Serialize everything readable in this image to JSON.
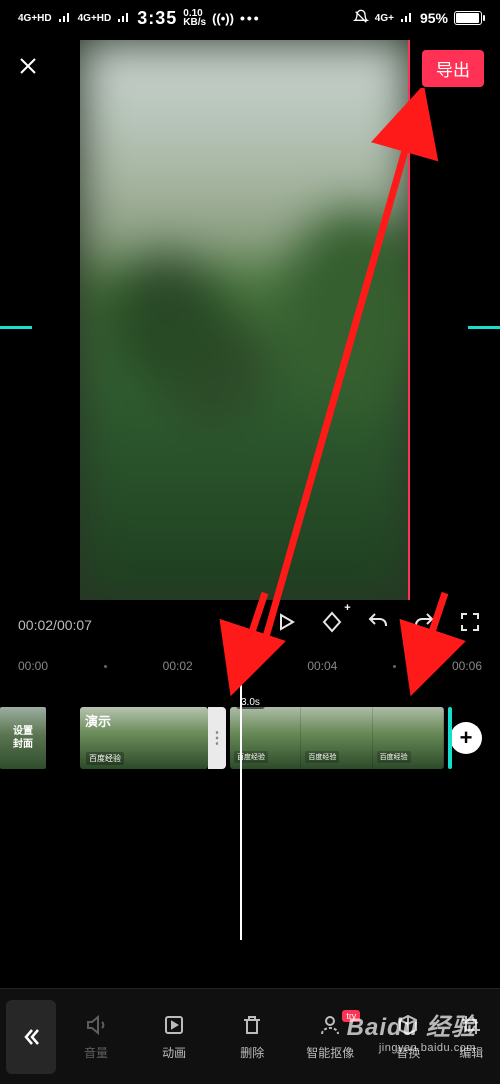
{
  "status": {
    "net_left": "4G+HD",
    "net_left2": "4G+HD",
    "time": "3:35",
    "speed_top": "0.10",
    "speed_bot": "KB/s",
    "net_right": "4G+",
    "battery": "95%"
  },
  "topbar": {
    "export_label": "导出"
  },
  "player": {
    "time_elapsed": "00:02",
    "time_total": "00:07"
  },
  "ruler": {
    "t0": "00:00",
    "t1": "00:02",
    "t2": "00:04",
    "t3": "00:06"
  },
  "timeline": {
    "cover_l1": "设置",
    "cover_l2": "封面",
    "clip1_title": "演示",
    "clip1_sub": "百度经验",
    "clip2_duration": "3.0s",
    "segment_wm": "百度经验"
  },
  "bottombar": {
    "volume": "音量",
    "anim": "动画",
    "delete": "删除",
    "matting": "智能抠像",
    "matting_badge": "try",
    "replace": "替换",
    "edit": "编辑"
  },
  "watermark": {
    "brand": "Baidu 经验",
    "url": "jingyan.baidu.com"
  }
}
